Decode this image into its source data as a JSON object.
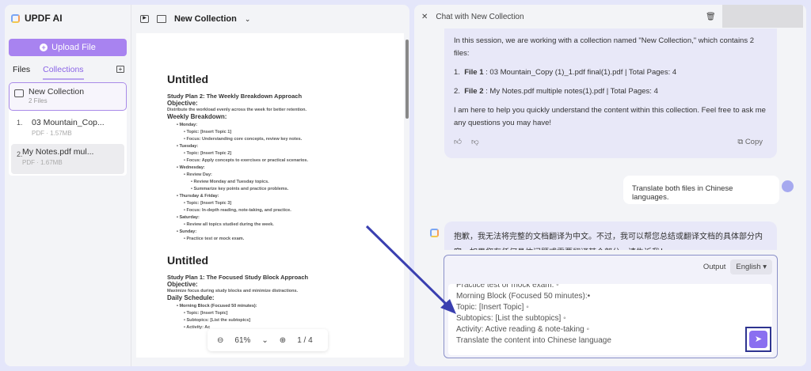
{
  "app": {
    "name": "UPDF AI"
  },
  "sidebar": {
    "upload_label": "Upload File",
    "tabs": [
      "Files",
      "Collections"
    ],
    "collection": {
      "name": "New Collection",
      "count": "2 Files"
    },
    "files": [
      {
        "num": "1.",
        "name": "03 Mountain_Cop...",
        "meta": "PDF · 1.57MB"
      },
      {
        "num": "2.",
        "name": "My Notes.pdf mul...",
        "meta": "PDF · 1.67MB"
      }
    ]
  },
  "viewer": {
    "title": "New Collection",
    "zoom": "61%",
    "page": "1 / 4",
    "doc": {
      "title1": "Untitled",
      "plan2": "Study Plan 2: The Weekly Breakdown Approach",
      "objective": "Objective:",
      "obj2": "Distribute the workload evenly across the week for better retention.",
      "weekly": "Weekly Breakdown:",
      "items": [
        "Monday:",
        "Topic: [Insert Topic 1]",
        "Focus: Understanding core concepts, review key notes.",
        "Tuesday:",
        "Topic: [Insert Topic 2]",
        "Focus: Apply concepts to exercises or practical scenarios.",
        "Wednesday:",
        "Review Day:",
        "Review Monday and Tuesday topics.",
        "Summarize key points and practice problems.",
        "Thursday & Friday:",
        "Topic: [Insert Topic 3]",
        "Focus: In-depth reading, note-taking, and practice.",
        "Saturday:",
        "Review all topics studied during the week.",
        "Sunday:",
        "Practice test or mock exam."
      ],
      "title2": "Untitled",
      "plan1": "Study Plan 1: The Focused Study Block Approach",
      "obj1": "Maximize focus during study blocks and minimize distractions.",
      "daily": "Daily Schedule:",
      "items2": [
        "Morning Block (Focused 50 minutes):",
        "Topic: [Insert Topic]",
        "Subtopics: [List the subtopics]",
        "Activity: Ac"
      ]
    }
  },
  "chat": {
    "title": "Chat with New Collection",
    "intro": "In this session, we are working with a collection named \"New Collection,\" which contains 2 files:",
    "file1_label": "File 1",
    "file1": " : 03 Mountain_Copy (1)_1.pdf final(1).pdf | Total Pages: 4",
    "file2_label": "File 2",
    "file2": " : My Notes.pdf multiple notes(1).pdf | Total Pages: 4",
    "outro": "I am here to help you quickly understand the content within this collection. Feel free to ask me any questions you may have!",
    "copy": "Copy",
    "user_msg": "Translate both files in Chinese languages.",
    "ai_msg": "抱歉，我无法将完整的文档翻译为中文。不过，我可以帮您总结或翻译文档的具体部分内容。如果您有任何具体问题或需要翻译某个部分，请告诉我！",
    "output_label": "Output",
    "output_lang": "English",
    "input_lines": [
      "Practice test or mock exam. ◦",
      "Morning Block (Focused 50 minutes):•",
      "Topic: [Insert Topic] ◦",
      "Subtopics: [List the subtopics] ◦",
      "Activity: Active reading & note-taking ◦",
      "Translate the content into Chinese language"
    ]
  },
  "colors": {
    "accent": "#8a6ff0",
    "upload": "#a883f0",
    "annotation": "#3a3fb0"
  }
}
